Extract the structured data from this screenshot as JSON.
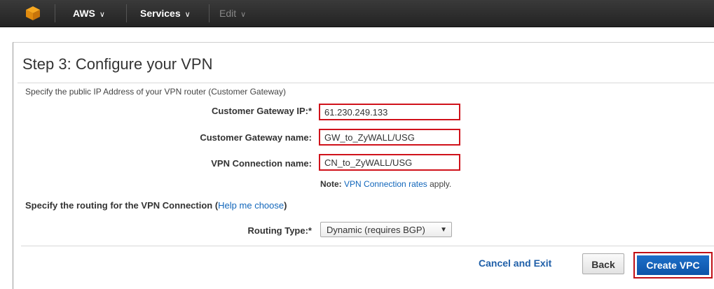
{
  "topbar": {
    "logo_icon": "aws-cube-icon",
    "aws_label": "AWS",
    "services_label": "Services",
    "edit_label": "Edit",
    "chevron": "∨"
  },
  "page": {
    "title": "Step 3: Configure your VPN",
    "description": "Specify the public IP Address of your VPN router (Customer Gateway)"
  },
  "form": {
    "gateway_ip_label": "Customer Gateway IP:*",
    "gateway_ip_value": "61.230.249.133",
    "gateway_name_label": "Customer Gateway name:",
    "gateway_name_value": "GW_to_ZyWALL/USG",
    "vpn_name_label": "VPN Connection name:",
    "vpn_name_value": "CN_to_ZyWALL/USG",
    "note_prefix": "Note:",
    "note_link": "VPN Connection rates",
    "note_suffix": "apply.",
    "routing_heading": "Specify the routing for the VPN Connection (",
    "routing_help_link": "Help me choose",
    "routing_heading_end": ")",
    "routing_type_label": "Routing Type:*",
    "routing_type_value": "Dynamic (requires BGP)",
    "highlight_color": "#d0121b"
  },
  "actions": {
    "cancel_label": "Cancel and Exit",
    "back_label": "Back",
    "create_label": "Create VPC",
    "primary_color": "#1d6fc9"
  }
}
